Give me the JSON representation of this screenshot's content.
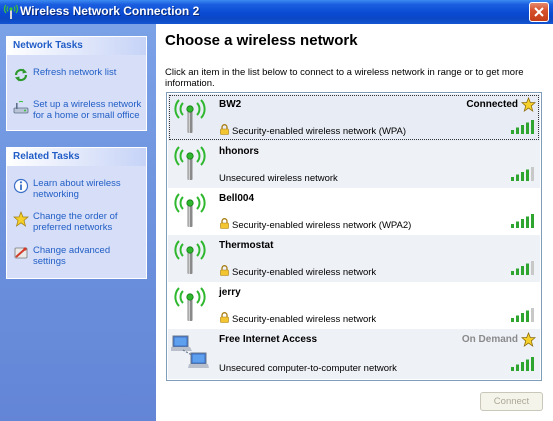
{
  "window": {
    "title": "Wireless Network Connection 2"
  },
  "sidebar": {
    "network_tasks": {
      "header": "Network Tasks",
      "items": [
        {
          "label": "Refresh network list",
          "icon": "refresh-icon"
        },
        {
          "label": "Set up a wireless network for a home or small office",
          "icon": "wireless-setup-icon"
        }
      ]
    },
    "related_tasks": {
      "header": "Related Tasks",
      "items": [
        {
          "label": "Learn about wireless networking",
          "icon": "info-icon"
        },
        {
          "label": "Change the order of preferred networks",
          "icon": "star-icon"
        },
        {
          "label": "Change advanced settings",
          "icon": "settings-icon"
        }
      ]
    }
  },
  "main": {
    "heading": "Choose a wireless network",
    "instructions": "Click an item in the list below to connect to a wireless network in range or to get more information.",
    "networks": [
      {
        "name": "BW2",
        "status": "Connected",
        "security": "Security-enabled wireless network (WPA)",
        "secured": true,
        "signal_bars": 5,
        "type": "antenna"
      },
      {
        "name": "hhonors",
        "status": "",
        "security": "Unsecured wireless network",
        "secured": false,
        "signal_bars": 4,
        "type": "antenna"
      },
      {
        "name": "Bell004",
        "status": "",
        "security": "Security-enabled wireless network (WPA2)",
        "secured": true,
        "signal_bars": 5,
        "type": "antenna"
      },
      {
        "name": "Thermostat",
        "status": "",
        "security": "Security-enabled wireless network",
        "secured": true,
        "signal_bars": 4,
        "type": "antenna"
      },
      {
        "name": "jerry",
        "status": "",
        "security": "Security-enabled wireless network",
        "secured": true,
        "signal_bars": 4,
        "type": "antenna"
      },
      {
        "name": "Free Internet Access",
        "status": "On Demand",
        "security": "Unsecured computer-to-computer network",
        "secured": false,
        "signal_bars": 5,
        "type": "adhoc"
      }
    ],
    "connect_label": "Connect"
  },
  "colors": {
    "title_blue": "#0a4ad3",
    "sidebar_blue": "#6a8fdc",
    "link_blue": "#215dc6",
    "signal_green": "#2ea52e"
  }
}
